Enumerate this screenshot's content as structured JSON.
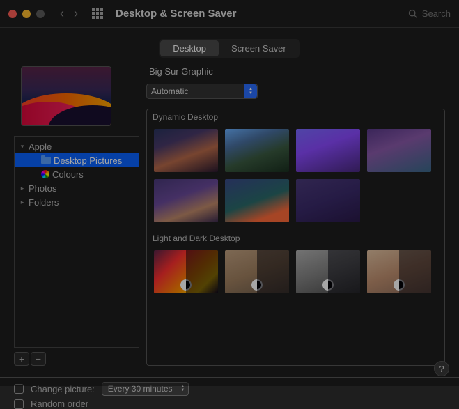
{
  "window": {
    "title": "Desktop & Screen Saver"
  },
  "search": {
    "placeholder": "Search"
  },
  "tabs": {
    "desktop": "Desktop",
    "screensaver": "Screen Saver"
  },
  "wallpaper": {
    "name": "Big Sur Graphic",
    "mode": "Automatic"
  },
  "sidebar": {
    "root0": "Apple",
    "child0": "Desktop Pictures",
    "child1": "Colours",
    "root1": "Photos",
    "root2": "Folders"
  },
  "sections": {
    "dynamic": "Dynamic Desktop",
    "lightdark": "Light and Dark Desktop"
  },
  "options": {
    "change_label": "Change picture:",
    "interval": "Every 30 minutes",
    "random_label": "Random order"
  },
  "help": "?"
}
